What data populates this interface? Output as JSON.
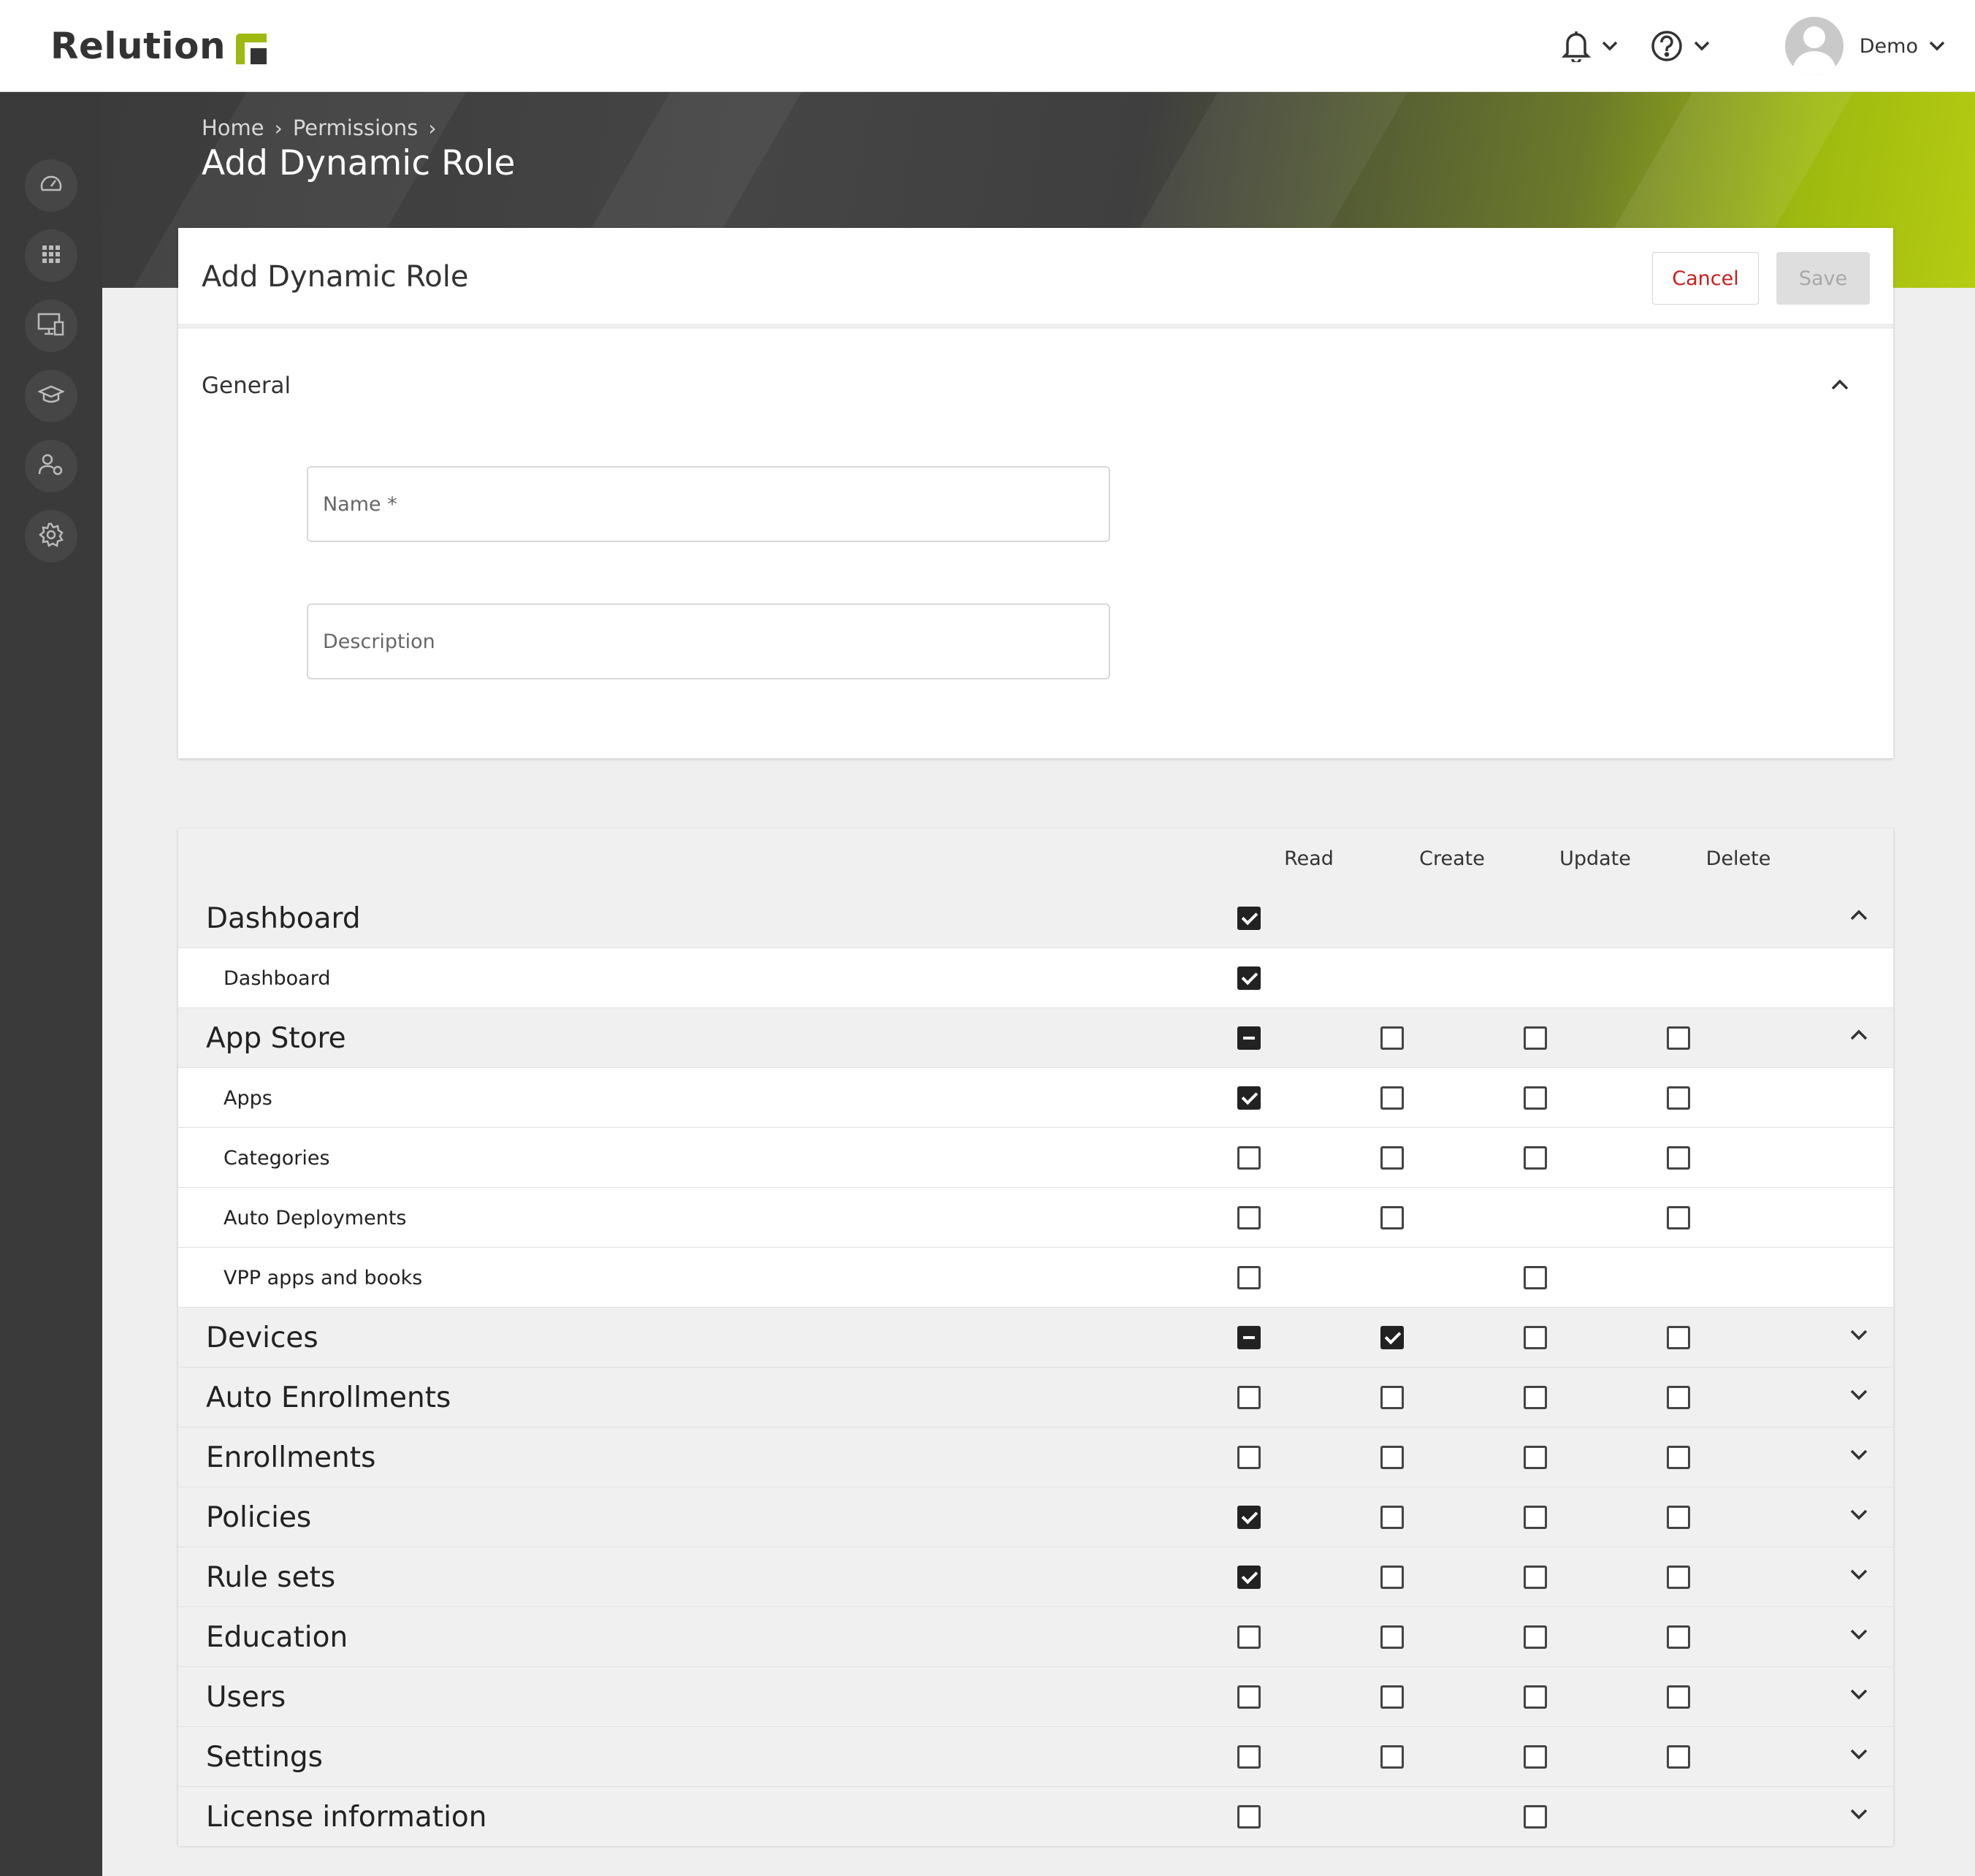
{
  "app": {
    "brand": "Relution",
    "brand_color": "#9eb90f",
    "accent_red": "#c8201e"
  },
  "header": {
    "notifications_icon": "bell-icon",
    "help_icon": "help-circle-icon",
    "user_name": "Demo"
  },
  "sidebar": {
    "items": [
      {
        "icon": "dashboard-gauge-icon"
      },
      {
        "icon": "apps-grid-icon"
      },
      {
        "icon": "devices-icon"
      },
      {
        "icon": "education-cap-icon"
      },
      {
        "icon": "users-settings-icon"
      },
      {
        "icon": "settings-gear-icon"
      }
    ]
  },
  "breadcrumb": {
    "items": [
      "Home",
      "Permissions"
    ]
  },
  "page": {
    "title": "Add Dynamic Role"
  },
  "form": {
    "title": "Add Dynamic Role",
    "cancel_label": "Cancel",
    "save_label": "Save",
    "section_label": "General",
    "name_placeholder": "Name *",
    "name_value": "",
    "description_placeholder": "Description",
    "description_value": ""
  },
  "permissions": {
    "columns": [
      "Read",
      "Create",
      "Update",
      "Delete"
    ],
    "rows": [
      {
        "type": "group",
        "label": "Dashboard",
        "expanded": true,
        "cells": [
          "checked",
          null,
          null,
          null
        ]
      },
      {
        "type": "sub",
        "label": "Dashboard",
        "cells": [
          "checked",
          null,
          null,
          null
        ]
      },
      {
        "type": "group",
        "label": "App Store",
        "expanded": true,
        "cells": [
          "indeterminate",
          "unchecked",
          "unchecked",
          "unchecked"
        ]
      },
      {
        "type": "sub",
        "label": "Apps",
        "cells": [
          "checked",
          "unchecked",
          "unchecked",
          "unchecked"
        ]
      },
      {
        "type": "sub",
        "label": "Categories",
        "cells": [
          "unchecked",
          "unchecked",
          "unchecked",
          "unchecked"
        ]
      },
      {
        "type": "sub",
        "label": "Auto Deployments",
        "cells": [
          "unchecked",
          "unchecked",
          null,
          "unchecked"
        ]
      },
      {
        "type": "sub",
        "label": "VPP apps and books",
        "cells": [
          "unchecked",
          null,
          "unchecked",
          null
        ]
      },
      {
        "type": "group",
        "label": "Devices",
        "expanded": false,
        "cells": [
          "indeterminate",
          "checked",
          "unchecked",
          "unchecked"
        ]
      },
      {
        "type": "group",
        "label": "Auto Enrollments",
        "expanded": false,
        "cells": [
          "unchecked",
          "unchecked",
          "unchecked",
          "unchecked"
        ]
      },
      {
        "type": "group",
        "label": "Enrollments",
        "expanded": false,
        "cells": [
          "unchecked",
          "unchecked",
          "unchecked",
          "unchecked"
        ]
      },
      {
        "type": "group",
        "label": "Policies",
        "expanded": false,
        "cells": [
          "checked",
          "unchecked",
          "unchecked",
          "unchecked"
        ]
      },
      {
        "type": "group",
        "label": "Rule sets",
        "expanded": false,
        "cells": [
          "checked",
          "unchecked",
          "unchecked",
          "unchecked"
        ]
      },
      {
        "type": "group",
        "label": "Education",
        "expanded": false,
        "cells": [
          "unchecked",
          "unchecked",
          "unchecked",
          "unchecked"
        ]
      },
      {
        "type": "group",
        "label": "Users",
        "expanded": false,
        "cells": [
          "unchecked",
          "unchecked",
          "unchecked",
          "unchecked"
        ]
      },
      {
        "type": "group",
        "label": "Settings",
        "expanded": false,
        "cells": [
          "unchecked",
          "unchecked",
          "unchecked",
          "unchecked"
        ]
      },
      {
        "type": "group",
        "label": "License information",
        "expanded": false,
        "cells": [
          "unchecked",
          null,
          "unchecked",
          null
        ]
      }
    ]
  }
}
